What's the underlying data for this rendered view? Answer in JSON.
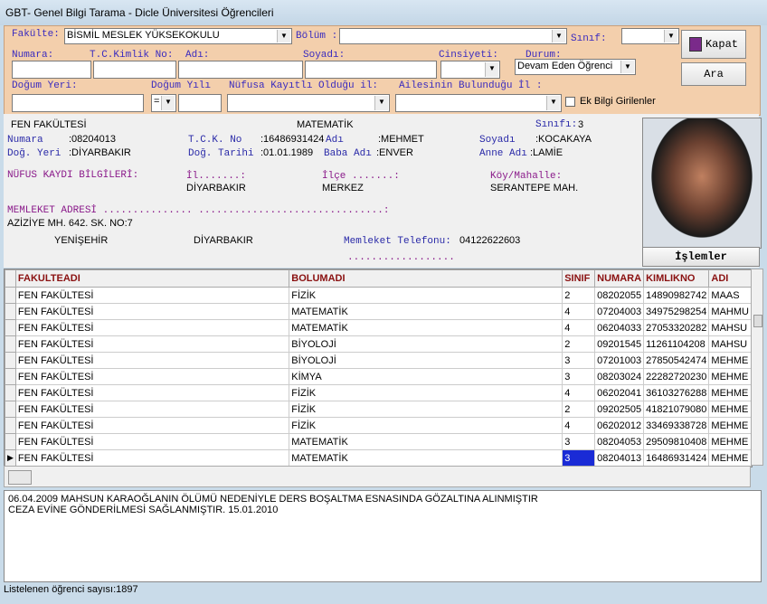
{
  "window": {
    "title": "GBT- Genel Bilgi Tarama - Dicle Üniversitesi Öğrencileri"
  },
  "filters": {
    "fakulte_label": "Fakülte:",
    "fakulte_value": "BİSMİL MESLEK YÜKSEKOKULU",
    "bolum_label": "Bölüm :",
    "bolum_value": "",
    "sinif_label": "Sınıf:",
    "sinif_value": "",
    "numara_label": "Numara:",
    "tckimlik_label": "T.C.Kimlik No:",
    "adi_label": "Adı:",
    "soyadi_label": "Soyadı:",
    "cinsiyet_label": "Cinsiyeti:",
    "durum_label": "Durum:",
    "durum_value": "Devam Eden Öğrenci",
    "dogum_yeri_label": "Doğum Yeri:",
    "dogum_yili_label": "Doğum Yılı",
    "dogum_yili_op": "=",
    "nufus_label": "Nüfusa Kayıtlı Olduğu il:",
    "ailesi_label": "Ailesinin Bulunduğu İl :",
    "ek_bilgi_label": "Ek Bilgi Girilenler",
    "kapat_label": "Kapat",
    "ara_label": "Ara"
  },
  "student": {
    "fakulte": "FEN FAKÜLTESİ",
    "bolum": "MATEMATİK",
    "sinif_label": "Sınıfı:",
    "sinif": "3",
    "numara_label": "Numara",
    "numara": ":08204013",
    "tck_label": "T.C.K. No",
    "tck": ":16486931424",
    "adi_label": "Adı",
    "adi": ":MEHMET",
    "soyadi_label": "Soyadı",
    "soyadi": ":KOCAKAYA",
    "dog_yeri_label": "Doğ. Yeri",
    "dog_yeri": ":DİYARBAKIR",
    "dog_tarihi_label": "Doğ. Tarihi",
    "dog_tarihi": ":01.01.1989",
    "baba_label": "Baba Adı",
    "baba": ":ENVER",
    "anne_label": "Anne Adı",
    "anne": ":LAMİE",
    "nufus_title": "NÜFUS KAYDI BİLGİLERİ:",
    "il_label": "İl.......:",
    "il": "DİYARBAKIR",
    "ilce_label": "İlçe .......:",
    "ilce": "MERKEZ",
    "koy_label": "Köy/Mahalle:",
    "koy": "SERANTEPE MAH.",
    "memleket_title": "MEMLEKET ADRESİ ............... ...............................:",
    "adres": "AZİZİYE MH. 642. SK. NO:7",
    "adres_ilce": "YENİŞEHİR",
    "adres_il": "DİYARBAKIR",
    "tel_label": "Memleket Telefonu:",
    "tel": "04122622603",
    "dots": "..................",
    "islemler_label": "İşlemler"
  },
  "grid": {
    "columns": [
      "FAKULTEADI",
      "BOLUMADI",
      "SINIF",
      "NUMARA",
      "KIMLIKNO",
      "ADI"
    ],
    "rows": [
      [
        "FEN FAKÜLTESİ",
        "FİZİK",
        "2",
        "08202055",
        "14890982742",
        "MAAS"
      ],
      [
        "FEN FAKÜLTESİ",
        "MATEMATİK",
        "4",
        "07204003",
        "34975298254",
        "MAHMU"
      ],
      [
        "FEN FAKÜLTESİ",
        "MATEMATİK",
        "4",
        "06204033",
        "27053320282",
        "MAHSU"
      ],
      [
        "FEN FAKÜLTESİ",
        "BİYOLOJİ",
        "2",
        "09201545",
        "11261104208",
        "MAHSU"
      ],
      [
        "FEN FAKÜLTESİ",
        "BİYOLOJİ",
        "3",
        "07201003",
        "27850542474",
        "MEHME"
      ],
      [
        "FEN FAKÜLTESİ",
        "KİMYA",
        "3",
        "08203024",
        "22282720230",
        "MEHME"
      ],
      [
        "FEN FAKÜLTESİ",
        "FİZİK",
        "4",
        "06202041",
        "36103276288",
        "MEHME"
      ],
      [
        "FEN FAKÜLTESİ",
        "FİZİK",
        "2",
        "09202505",
        "41821079080",
        "MEHME"
      ],
      [
        "FEN FAKÜLTESİ",
        "FİZİK",
        "4",
        "06202012",
        "33469338728",
        "MEHME"
      ],
      [
        "FEN FAKÜLTESİ",
        "MATEMATİK",
        "3",
        "08204053",
        "29509810408",
        "MEHME"
      ],
      [
        "FEN FAKÜLTESİ",
        "MATEMATİK",
        "3",
        "08204013",
        "16486931424",
        "MEHME"
      ]
    ],
    "current_row_marker": "▶"
  },
  "notes": {
    "line1": "06.04.2009 MAHSUN KARAOĞLANIN ÖLÜMÜ NEDENİYLE   DERS BOŞALTMA  ESNASINDA GÖZALTINA ALINMIŞTIR",
    "line2": "CEZA EVİNE GÖNDERİLMESİ SAĞLANMIŞTIR.  15.01.2010"
  },
  "status": {
    "text": "Listelenen öğrenci sayısı:1897"
  },
  "icons": {
    "dropdown": "▾",
    "scroll_left": "◀"
  }
}
